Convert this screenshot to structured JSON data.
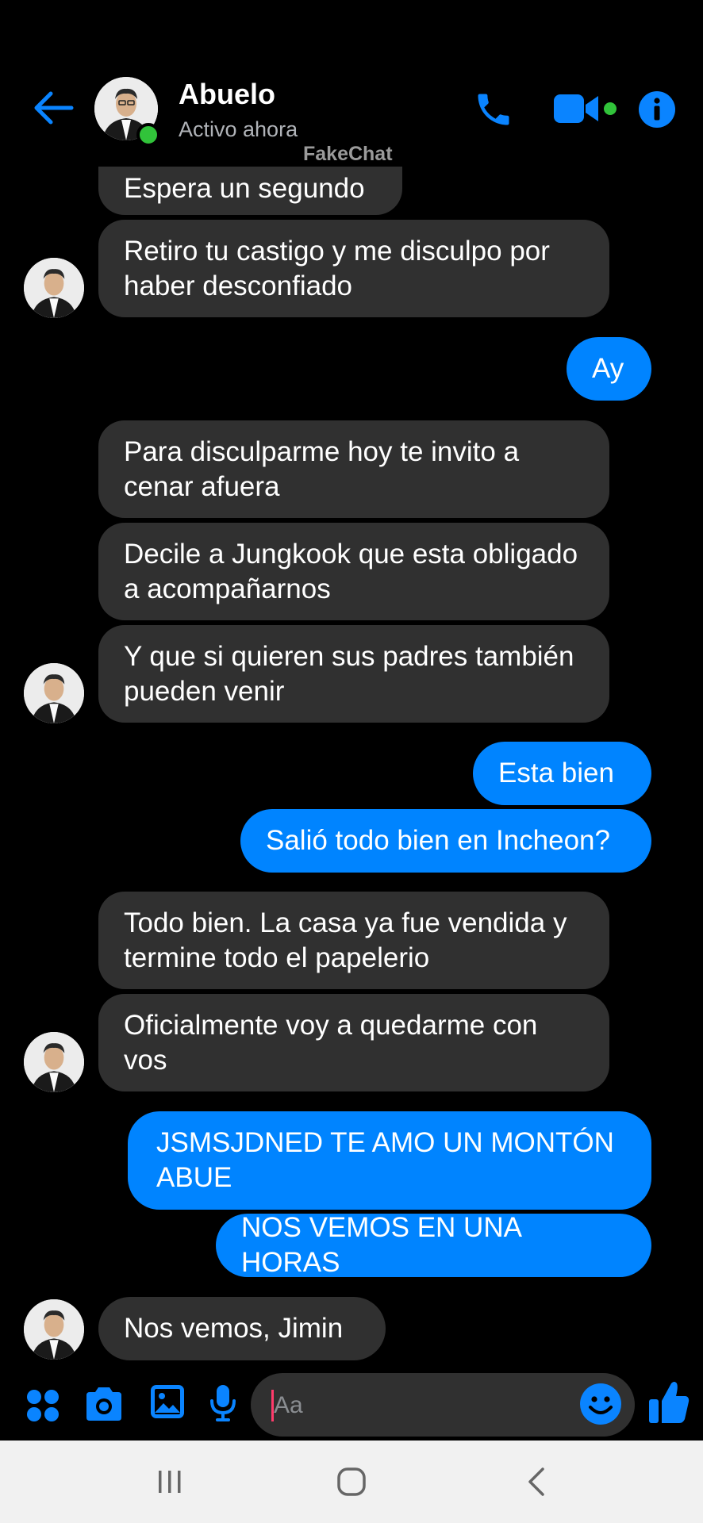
{
  "header": {
    "contact_name": "Abuelo",
    "status": "Activo ahora",
    "watermark": "FakeChat",
    "icons": [
      "back-arrow-icon",
      "phone-icon",
      "video-camera-icon",
      "info-icon"
    ]
  },
  "messages": [
    {
      "side": "in",
      "text": "Espera un segundo"
    },
    {
      "side": "in",
      "text": "Retiro tu castigo y me disculpo por haber desconfiado"
    },
    {
      "side": "out",
      "text": "Ay"
    },
    {
      "side": "in",
      "text": "Para disculparme hoy te invito a cenar afuera"
    },
    {
      "side": "in",
      "text": "Decile a Jungkook que esta obligado a acompañarnos"
    },
    {
      "side": "in",
      "text": "Y que si quieren sus padres también pueden venir"
    },
    {
      "side": "out",
      "text": "Esta bien"
    },
    {
      "side": "out",
      "text": "Salió todo bien en Incheon?"
    },
    {
      "side": "in",
      "text": "Todo bien. La casa ya fue vendida y termine todo el papelerio"
    },
    {
      "side": "in",
      "text": "Oficialmente voy a quedarme con vos"
    },
    {
      "side": "out",
      "text": "JSMSJDNED TE AMO UN MONTÓN ABUE"
    },
    {
      "side": "out",
      "text": "NOS VEMOS EN UNA HORAS"
    },
    {
      "side": "in",
      "text": "Nos vemos, Jimin"
    }
  ],
  "composer": {
    "placeholder": "Aa",
    "icons": [
      "apps-icon",
      "camera-icon",
      "gallery-icon",
      "microphone-icon",
      "emoji-icon",
      "thumbs-up-icon"
    ]
  },
  "navbar": {
    "icons": [
      "recent-apps-icon",
      "home-icon",
      "back-icon"
    ]
  },
  "colors": {
    "accent": "#0084ff",
    "incoming_bubble": "#303030",
    "online": "#31c33a",
    "background": "#000000"
  }
}
